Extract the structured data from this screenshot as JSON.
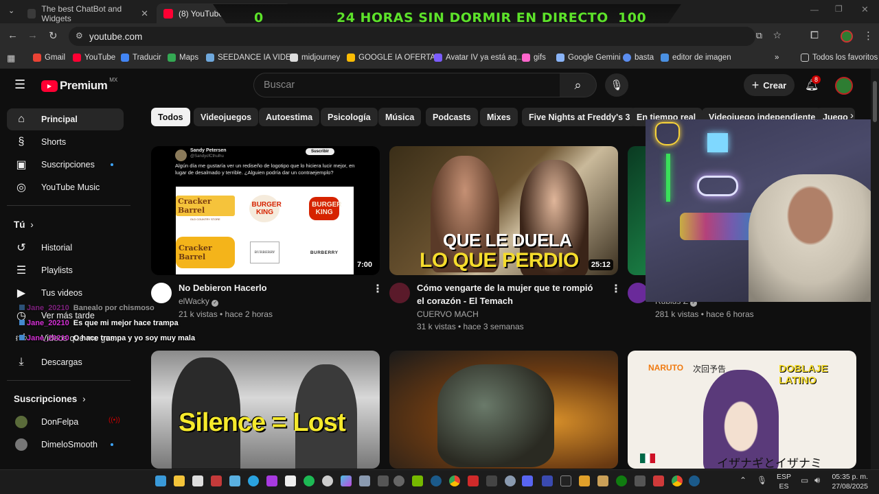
{
  "browser": {
    "tabs": [
      {
        "title": "The best ChatBot and Widgets",
        "close": "✕"
      },
      {
        "title": "(8) YouTube",
        "close": "✕"
      }
    ],
    "new_tab": "+",
    "url": "youtube.com",
    "bookmarks": [
      "Gmail",
      "YouTube",
      "Traducir",
      "Maps",
      "SEEDANCE IA VIDEO",
      "midjourney",
      "GOOGLE IA OFERTA...",
      "Avatar IV ya está aq...",
      "gifs",
      "Google Gemini",
      "basta",
      "editor de imagen"
    ],
    "bookmarks_more": "»",
    "all_favorites": "Todos los favoritos"
  },
  "stream_overlay": {
    "left_count": "0",
    "title": "24 HORAS SIN DORMIR EN DIRECTO",
    "right_count": "100"
  },
  "youtube": {
    "logo": "Premium",
    "region": "MX",
    "search_placeholder": "Buscar",
    "create_label": "Crear",
    "notifications": "8",
    "sidebar": {
      "main": [
        {
          "label": "Principal",
          "icon": "home-icon"
        },
        {
          "label": "Shorts",
          "icon": "shorts-icon"
        },
        {
          "label": "Suscripciones",
          "icon": "subscriptions-icon"
        },
        {
          "label": "YouTube Music",
          "icon": "music-icon"
        }
      ],
      "you_heading": "Tú",
      "you": [
        {
          "label": "Historial",
          "icon": "history-icon"
        },
        {
          "label": "Playlists",
          "icon": "playlists-icon"
        },
        {
          "label": "Tus videos",
          "icon": "your-videos-icon"
        },
        {
          "label": "Ver más tarde",
          "icon": "watch-later-icon"
        },
        {
          "label": "Videos que me gus...",
          "icon": "like-icon"
        },
        {
          "label": "Descargas",
          "icon": "download-icon"
        }
      ],
      "subs_heading": "Suscripciones",
      "subs": [
        {
          "label": "DonFelpa",
          "indicator": "live"
        },
        {
          "label": "DimeloSmooth",
          "indicator": "dot"
        }
      ]
    },
    "chips": [
      "Todos",
      "Videojuegos",
      "Autoestima",
      "Psicología",
      "Música",
      "Podcasts",
      "Mixes",
      "Five Nights at Freddy's 3",
      "En tiempo real",
      "Videojuego independiente",
      "Juego"
    ],
    "videos": [
      {
        "title": "No Debieron Hacerlo",
        "channel": "elWacky",
        "meta": "21 k vistas • hace 2 horas",
        "duration": "7:00",
        "thumb_text": {
          "author": "Sandy Petersen",
          "handle": "@SandyofCthulhu",
          "follow": "Suscribir",
          "tweet": "Algún día me gustaría ver un rediseño de logotipo que lo hiciera lucir mejor, en lugar de desalmado y terrible. ¿Alguien podría dar un contraejemplo?",
          "logos": [
            "Cracker Barrel",
            "BURGER KING",
            "BURGER KING",
            "Cracker Barrel",
            "BURBERRY",
            "BURBERRY"
          ],
          "cb_sub": "OLD COUNTRY STORE"
        }
      },
      {
        "title": "Cómo vengarte de la mujer que te rompió el corazón - El Temach",
        "channel": "CUERVO MACH",
        "meta": "31 k vistas • hace 3 semanas",
        "duration": "25:12",
        "thumb_text": [
          "QUE LE DUELA",
          "LO QUE PERDIO"
        ]
      },
      {
        "title": "",
        "channel": "Rubius Z",
        "meta": "281 k vistas • hace 6 horas",
        "duration": ""
      },
      {
        "thumb_text": "Silence = Lost"
      },
      {
        "thumb_text": ""
      },
      {
        "thumb_text": [
          "NARUTO",
          "次回予告",
          "DOBLAJE LATINO",
          "イザナギとイザナミ"
        ]
      }
    ]
  },
  "chat_overlay": [
    {
      "user": "Jane_20210",
      "msg": "Banealo por chismoso"
    },
    {
      "user": "Jane_20210",
      "msg": "Es que mi mejor hace trampa"
    },
    {
      "user": "Jane_20210",
      "msg": "O hace trampa y yo soy muy mala"
    }
  ],
  "taskbar": {
    "lang_top": "ESP",
    "lang_bottom": "ES",
    "time": "05:35 p. m.",
    "date": "27/08/2025"
  },
  "colors": {
    "yt_red": "#ff0033",
    "overlay_green": "#5de32a",
    "chat_user": "#d52fd5",
    "bg": "#0f0f0f"
  }
}
